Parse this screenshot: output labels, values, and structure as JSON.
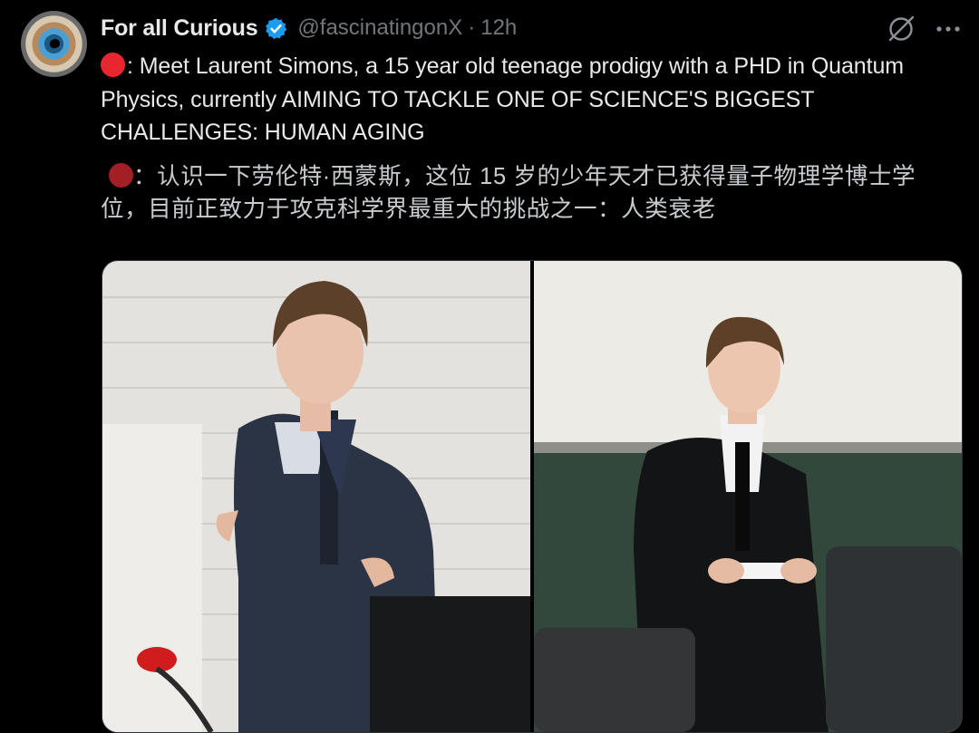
{
  "tweet": {
    "display_name": "For all Curious",
    "handle": "@fascinatingonX",
    "separator": "·",
    "time": "12h",
    "text": ": Meet Laurent Simons, a 15 year old teenage prodigy with a PHD in Quantum Physics, currently AIMING TO TACKLE ONE OF SCIENCE'S BIGGEST CHALLENGES: HUMAN AGING",
    "translation": "：认识一下劳伦特·西蒙斯，这位 15 岁的少年天才已获得量子物理学博士学位，目前正致力于攻克科学界最重大的挑战之一：人类衰老"
  },
  "icons": {
    "verified": "verified-badge-icon",
    "grok": "grok-icon",
    "more": "more-icon",
    "red_circle": "red-circle-emoji"
  },
  "colors": {
    "background": "#000000",
    "primary_text": "#e7e9ea",
    "secondary_text": "#71767b",
    "verified_blue": "#1d9bf0",
    "emoji_red": "#e8262f"
  }
}
